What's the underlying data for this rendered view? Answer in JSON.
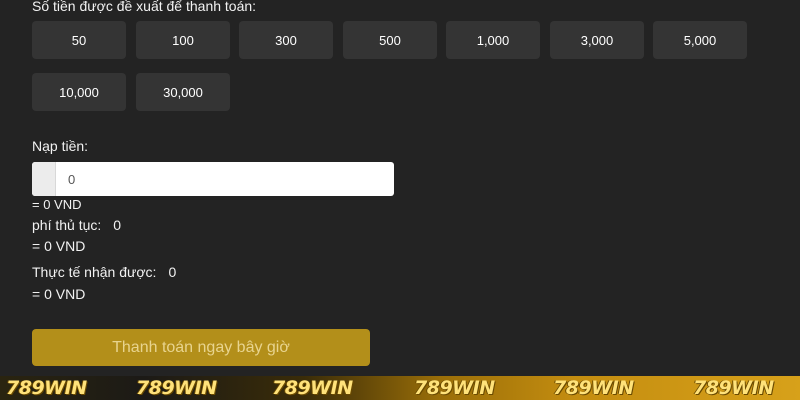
{
  "suggested": {
    "label": "Số tiền được đề xuất để thanh toán:",
    "amounts": [
      "50",
      "100",
      "300",
      "500",
      "1,000",
      "3,000",
      "5,000",
      "10,000",
      "30,000"
    ]
  },
  "deposit": {
    "label": "Nạp tiền:",
    "placeholder": "0",
    "converted": "= 0 VND"
  },
  "fee": {
    "label": "phí thủ tục:",
    "value": "0",
    "converted": "= 0 VND"
  },
  "received": {
    "label": "Thực tế nhận được:",
    "value": "0",
    "converted": "= 0 VND"
  },
  "pay_button": {
    "label": "Thanh toán ngay bây giờ"
  },
  "brand": {
    "logo_text": "789WIN"
  },
  "colors": {
    "background": "#232323",
    "amount_button": "#343434",
    "pay_button": "#b38f1a",
    "brand_logo": "#ffe27a"
  }
}
